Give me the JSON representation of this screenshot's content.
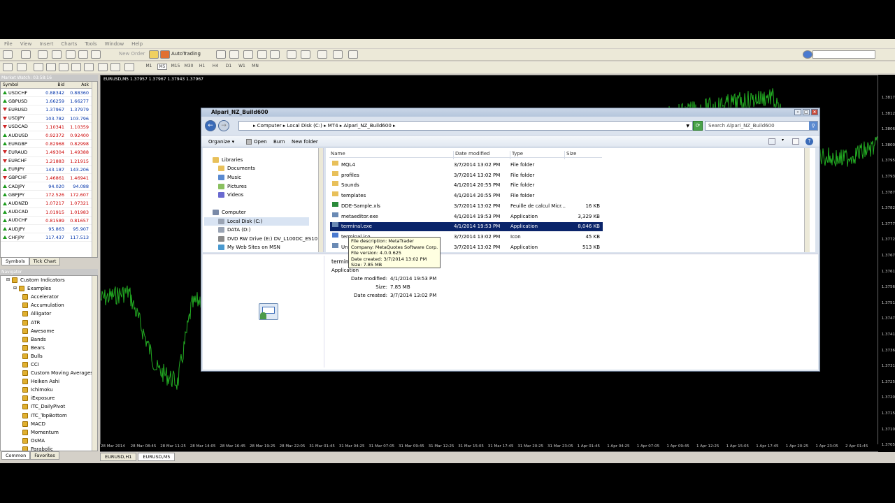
{
  "menu": [
    "File",
    "View",
    "Insert",
    "Charts",
    "Tools",
    "Window",
    "Help"
  ],
  "toolbar": {
    "new_order": "New Order",
    "autotrading": "AutoTrading"
  },
  "timeframes": [
    "M1",
    "M5",
    "M15",
    "M30",
    "H1",
    "H4",
    "D1",
    "W1",
    "MN"
  ],
  "market_watch": {
    "title": "Market Watch: 03:58:16",
    "headers": [
      "Symbol",
      "Bid",
      "Ask"
    ],
    "rows": [
      {
        "symbol": "USDCHF",
        "bid": "0.88342",
        "ask": "0.88360",
        "dir": "up",
        "color": "blue"
      },
      {
        "symbol": "GBPUSD",
        "bid": "1.66259",
        "ask": "1.66277",
        "dir": "up",
        "color": "blue"
      },
      {
        "symbol": "EURUSD",
        "bid": "1.37967",
        "ask": "1.37979",
        "dir": "down",
        "color": "blue"
      },
      {
        "symbol": "USDJPY",
        "bid": "103.782",
        "ask": "103.796",
        "dir": "down",
        "color": "blue"
      },
      {
        "symbol": "USDCAD",
        "bid": "1.10341",
        "ask": "1.10359",
        "dir": "down",
        "color": "red"
      },
      {
        "symbol": "AUDUSD",
        "bid": "0.92372",
        "ask": "0.92400",
        "dir": "up",
        "color": "red"
      },
      {
        "symbol": "EURGBP",
        "bid": "0.82968",
        "ask": "0.82998",
        "dir": "up",
        "color": "red"
      },
      {
        "symbol": "EURAUD",
        "bid": "1.49304",
        "ask": "1.49388",
        "dir": "down",
        "color": "red"
      },
      {
        "symbol": "EURCHF",
        "bid": "1.21883",
        "ask": "1.21915",
        "dir": "down",
        "color": "red"
      },
      {
        "symbol": "EURJPY",
        "bid": "143.187",
        "ask": "143.206",
        "dir": "up",
        "color": "blue"
      },
      {
        "symbol": "GBPCHF",
        "bid": "1.46861",
        "ask": "1.46941",
        "dir": "down",
        "color": "red"
      },
      {
        "symbol": "CADJPY",
        "bid": "94.020",
        "ask": "94.088",
        "dir": "up",
        "color": "blue"
      },
      {
        "symbol": "GBPJPY",
        "bid": "172.526",
        "ask": "172.607",
        "dir": "up",
        "color": "red"
      },
      {
        "symbol": "AUDNZD",
        "bid": "1.07217",
        "ask": "1.07321",
        "dir": "up",
        "color": "red"
      },
      {
        "symbol": "AUDCAD",
        "bid": "1.01915",
        "ask": "1.01983",
        "dir": "up",
        "color": "red"
      },
      {
        "symbol": "AUDCHF",
        "bid": "0.81589",
        "ask": "0.81657",
        "dir": "up",
        "color": "red"
      },
      {
        "symbol": "AUDJPY",
        "bid": "95.863",
        "ask": "95.907",
        "dir": "up",
        "color": "blue"
      },
      {
        "symbol": "CHFJPY",
        "bid": "117.437",
        "ask": "117.513",
        "dir": "up",
        "color": "blue"
      }
    ],
    "tabs": [
      "Symbols",
      "Tick Chart"
    ]
  },
  "navigator": {
    "title": "Navigator",
    "root": "Custom Indicators",
    "items": [
      "Examples",
      "Accelerator",
      "Accumulation",
      "Alligator",
      "ATR",
      "Awesome",
      "Bands",
      "Bears",
      "Bulls",
      "CCI",
      "Custom Moving Averages",
      "Heiken Ashi",
      "Ichimoku",
      "iExposure",
      "ITC_DailyPivot",
      "ITC_TopBottom",
      "MACD",
      "Momentum",
      "OsMA",
      "Parabolic"
    ],
    "tabs": [
      "Common",
      "Favorites"
    ]
  },
  "chart": {
    "title": "EURUSD,M5  1.37957 1.37967 1.37943 1.37967",
    "y_ticks": [
      "1.3817",
      "1.3812",
      "1.3806",
      "1.3800",
      "1.3795",
      "1.3793",
      "1.3787",
      "1.3782",
      "1.3777",
      "1.3772",
      "1.3767",
      "1.3761",
      "1.3756",
      "1.3751",
      "1.3747",
      "1.3741",
      "1.3736",
      "1.3731",
      "1.3725",
      "1.3720",
      "1.3715",
      "1.3710",
      "1.3705"
    ],
    "x_ticks": [
      "28 Mar 2014",
      "28 Mar 08:45",
      "28 Mar 11:25",
      "28 Mar 14:05",
      "28 Mar 16:45",
      "28 Mar 19:25",
      "28 Mar 22:05",
      "31 Mar 01:45",
      "31 Mar 04:25",
      "31 Mar 07:05",
      "31 Mar 09:45",
      "31 Mar 12:25",
      "31 Mar 15:05",
      "31 Mar 17:45",
      "31 Mar 20:25",
      "31 Mar 23:05",
      "1 Apr 01:45",
      "1 Apr 04:25",
      "1 Apr 07:05",
      "1 Apr 09:45",
      "1 Apr 12:25",
      "1 Apr 15:05",
      "1 Apr 17:45",
      "1 Apr 20:25",
      "1 Apr 23:05",
      "2 Apr 01:45"
    ],
    "tabs": [
      "EURUSD,H1",
      "EURUSD,M5"
    ],
    "line_color": "#22aa22"
  },
  "explorer": {
    "title": "Alpari_NZ_Build600",
    "breadcrumb": "▸  Computer  ▸  Local Disk (C:)  ▸  MT4  ▸  Alpari_NZ_Build600  ▸",
    "search_placeholder": "Search Alpari_NZ_Build600",
    "commands": [
      "Organize ▾",
      "Open",
      "Burn",
      "New folder"
    ],
    "tree": [
      {
        "label": "Libraries",
        "level": 1,
        "icon": "library"
      },
      {
        "label": "Documents",
        "level": 2,
        "icon": "documents"
      },
      {
        "label": "Music",
        "level": 2,
        "icon": "music"
      },
      {
        "label": "Pictures",
        "level": 2,
        "icon": "pictures"
      },
      {
        "label": "Videos",
        "level": 2,
        "icon": "videos"
      },
      {
        "label": "Computer",
        "level": 1,
        "icon": "computer"
      },
      {
        "label": "Local Disk (C:)",
        "level": 2,
        "icon": "drive",
        "selected": true
      },
      {
        "label": "DATA (D:)",
        "level": 2,
        "icon": "drive"
      },
      {
        "label": "DVD RW Drive (E:) DV_L100DC_ES10",
        "level": 2,
        "icon": "dvd"
      },
      {
        "label": "My Web Sites on MSN",
        "level": 2,
        "icon": "web"
      }
    ],
    "columns": [
      "Name",
      "Date modified",
      "Type",
      "Size"
    ],
    "files": [
      {
        "name": "MQL4",
        "date": "3/7/2014 13:02 PM",
        "type": "File folder",
        "size": "",
        "icon": "folder"
      },
      {
        "name": "profiles",
        "date": "3/7/2014 13:02 PM",
        "type": "File folder",
        "size": "",
        "icon": "folder"
      },
      {
        "name": "Sounds",
        "date": "4/1/2014 20:55 PM",
        "type": "File folder",
        "size": "",
        "icon": "folder"
      },
      {
        "name": "templates",
        "date": "4/1/2014 20:55 PM",
        "type": "File folder",
        "size": "",
        "icon": "folder"
      },
      {
        "name": "DDE-Sample.xls",
        "date": "3/7/2014 13:02 PM",
        "type": "Feuille de calcul Micr...",
        "size": "16 KB",
        "icon": "xls"
      },
      {
        "name": "metaeditor.exe",
        "date": "4/1/2014 19:53 PM",
        "type": "Application",
        "size": "3,329 KB",
        "icon": "exe"
      },
      {
        "name": "terminal.exe",
        "date": "4/1/2014 19:53 PM",
        "type": "Application",
        "size": "8,046 KB",
        "icon": "exe",
        "selected": true
      },
      {
        "name": "terminal.ico",
        "date": "3/7/2014 13:02 PM",
        "type": "Icon",
        "size": "45 KB",
        "icon": "ico"
      },
      {
        "name": "Uninstall.exe",
        "date": "3/7/2014 13:02 PM",
        "type": "Application",
        "size": "513 KB",
        "icon": "exe"
      }
    ],
    "tooltip": [
      "File description: MetaTrader",
      "Company: MetaQuotes Software Corp.",
      "File version: 4.0.0.625",
      "Date created: 3/7/2014 13:02 PM",
      "Size: 7.85 MB"
    ],
    "details": {
      "name": "terminal.exe",
      "type": "Application",
      "date_modified_label": "Date modified:",
      "date_modified": "4/1/2014 19:53 PM",
      "size_label": "Size:",
      "size": "7.85 MB",
      "date_created_label": "Date created:",
      "date_created": "3/7/2014 13:02 PM"
    }
  }
}
